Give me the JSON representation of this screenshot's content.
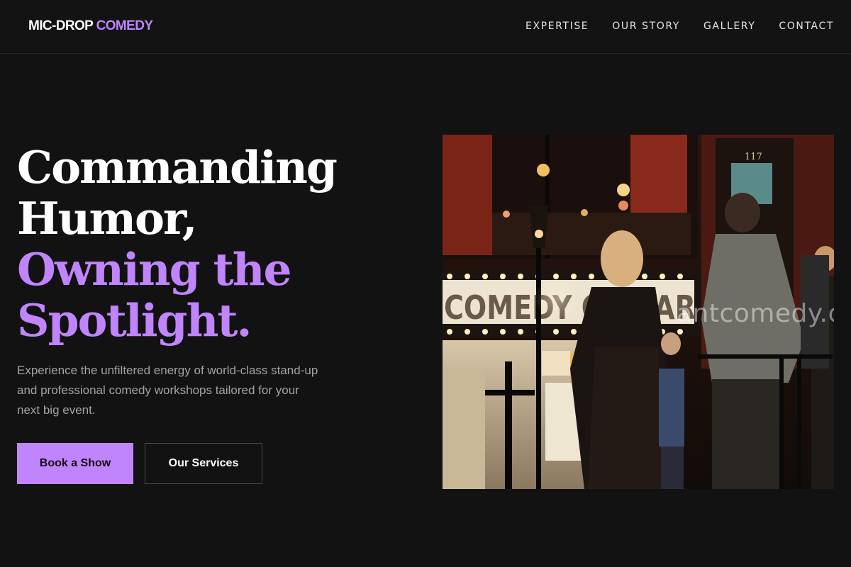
{
  "brand": {
    "name_part1": "MIC-DROP",
    "name_part2": "COMEDY",
    "accent_color": "#c084fc"
  },
  "nav": {
    "items": [
      {
        "label": "EXPERTISE"
      },
      {
        "label": "OUR STORY"
      },
      {
        "label": "GALLERY"
      },
      {
        "label": "CONTACT"
      }
    ]
  },
  "hero": {
    "headline_line1": "Commanding",
    "headline_line2": "Humor,",
    "headline_line3": "Owning the",
    "headline_line4": "Spotlight.",
    "description": "Experience the unfiltered energy of world-class stand-up and professional comedy workshops tailored for your next big event.",
    "primary_button": "Book a Show",
    "secondary_button": "Our Services"
  },
  "photo": {
    "marquee_text": "COMEDY CELLAR",
    "watermark": "antcomedy.com",
    "door_number": "117"
  },
  "colors": {
    "background": "#121212",
    "accent": "#c084fc",
    "body_text": "#a3a3a3"
  }
}
